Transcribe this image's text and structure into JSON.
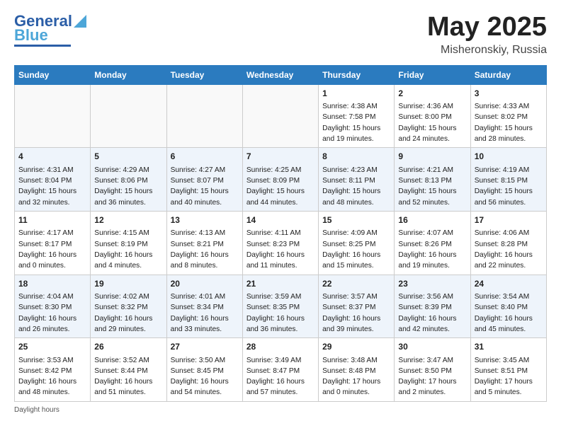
{
  "header": {
    "logo_line1": "General",
    "logo_line2": "Blue",
    "month_title": "May 2025",
    "subtitle": "Misheronskiy, Russia"
  },
  "weekdays": [
    "Sunday",
    "Monday",
    "Tuesday",
    "Wednesday",
    "Thursday",
    "Friday",
    "Saturday"
  ],
  "weeks": [
    [
      {
        "day": "",
        "info": ""
      },
      {
        "day": "",
        "info": ""
      },
      {
        "day": "",
        "info": ""
      },
      {
        "day": "",
        "info": ""
      },
      {
        "day": "1",
        "info": "Sunrise: 4:38 AM\nSunset: 7:58 PM\nDaylight: 15 hours\nand 19 minutes."
      },
      {
        "day": "2",
        "info": "Sunrise: 4:36 AM\nSunset: 8:00 PM\nDaylight: 15 hours\nand 24 minutes."
      },
      {
        "day": "3",
        "info": "Sunrise: 4:33 AM\nSunset: 8:02 PM\nDaylight: 15 hours\nand 28 minutes."
      }
    ],
    [
      {
        "day": "4",
        "info": "Sunrise: 4:31 AM\nSunset: 8:04 PM\nDaylight: 15 hours\nand 32 minutes."
      },
      {
        "day": "5",
        "info": "Sunrise: 4:29 AM\nSunset: 8:06 PM\nDaylight: 15 hours\nand 36 minutes."
      },
      {
        "day": "6",
        "info": "Sunrise: 4:27 AM\nSunset: 8:07 PM\nDaylight: 15 hours\nand 40 minutes."
      },
      {
        "day": "7",
        "info": "Sunrise: 4:25 AM\nSunset: 8:09 PM\nDaylight: 15 hours\nand 44 minutes."
      },
      {
        "day": "8",
        "info": "Sunrise: 4:23 AM\nSunset: 8:11 PM\nDaylight: 15 hours\nand 48 minutes."
      },
      {
        "day": "9",
        "info": "Sunrise: 4:21 AM\nSunset: 8:13 PM\nDaylight: 15 hours\nand 52 minutes."
      },
      {
        "day": "10",
        "info": "Sunrise: 4:19 AM\nSunset: 8:15 PM\nDaylight: 15 hours\nand 56 minutes."
      }
    ],
    [
      {
        "day": "11",
        "info": "Sunrise: 4:17 AM\nSunset: 8:17 PM\nDaylight: 16 hours\nand 0 minutes."
      },
      {
        "day": "12",
        "info": "Sunrise: 4:15 AM\nSunset: 8:19 PM\nDaylight: 16 hours\nand 4 minutes."
      },
      {
        "day": "13",
        "info": "Sunrise: 4:13 AM\nSunset: 8:21 PM\nDaylight: 16 hours\nand 8 minutes."
      },
      {
        "day": "14",
        "info": "Sunrise: 4:11 AM\nSunset: 8:23 PM\nDaylight: 16 hours\nand 11 minutes."
      },
      {
        "day": "15",
        "info": "Sunrise: 4:09 AM\nSunset: 8:25 PM\nDaylight: 16 hours\nand 15 minutes."
      },
      {
        "day": "16",
        "info": "Sunrise: 4:07 AM\nSunset: 8:26 PM\nDaylight: 16 hours\nand 19 minutes."
      },
      {
        "day": "17",
        "info": "Sunrise: 4:06 AM\nSunset: 8:28 PM\nDaylight: 16 hours\nand 22 minutes."
      }
    ],
    [
      {
        "day": "18",
        "info": "Sunrise: 4:04 AM\nSunset: 8:30 PM\nDaylight: 16 hours\nand 26 minutes."
      },
      {
        "day": "19",
        "info": "Sunrise: 4:02 AM\nSunset: 8:32 PM\nDaylight: 16 hours\nand 29 minutes."
      },
      {
        "day": "20",
        "info": "Sunrise: 4:01 AM\nSunset: 8:34 PM\nDaylight: 16 hours\nand 33 minutes."
      },
      {
        "day": "21",
        "info": "Sunrise: 3:59 AM\nSunset: 8:35 PM\nDaylight: 16 hours\nand 36 minutes."
      },
      {
        "day": "22",
        "info": "Sunrise: 3:57 AM\nSunset: 8:37 PM\nDaylight: 16 hours\nand 39 minutes."
      },
      {
        "day": "23",
        "info": "Sunrise: 3:56 AM\nSunset: 8:39 PM\nDaylight: 16 hours\nand 42 minutes."
      },
      {
        "day": "24",
        "info": "Sunrise: 3:54 AM\nSunset: 8:40 PM\nDaylight: 16 hours\nand 45 minutes."
      }
    ],
    [
      {
        "day": "25",
        "info": "Sunrise: 3:53 AM\nSunset: 8:42 PM\nDaylight: 16 hours\nand 48 minutes."
      },
      {
        "day": "26",
        "info": "Sunrise: 3:52 AM\nSunset: 8:44 PM\nDaylight: 16 hours\nand 51 minutes."
      },
      {
        "day": "27",
        "info": "Sunrise: 3:50 AM\nSunset: 8:45 PM\nDaylight: 16 hours\nand 54 minutes."
      },
      {
        "day": "28",
        "info": "Sunrise: 3:49 AM\nSunset: 8:47 PM\nDaylight: 16 hours\nand 57 minutes."
      },
      {
        "day": "29",
        "info": "Sunrise: 3:48 AM\nSunset: 8:48 PM\nDaylight: 17 hours\nand 0 minutes."
      },
      {
        "day": "30",
        "info": "Sunrise: 3:47 AM\nSunset: 8:50 PM\nDaylight: 17 hours\nand 2 minutes."
      },
      {
        "day": "31",
        "info": "Sunrise: 3:45 AM\nSunset: 8:51 PM\nDaylight: 17 hours\nand 5 minutes."
      }
    ]
  ],
  "footer": {
    "note": "Daylight hours"
  }
}
